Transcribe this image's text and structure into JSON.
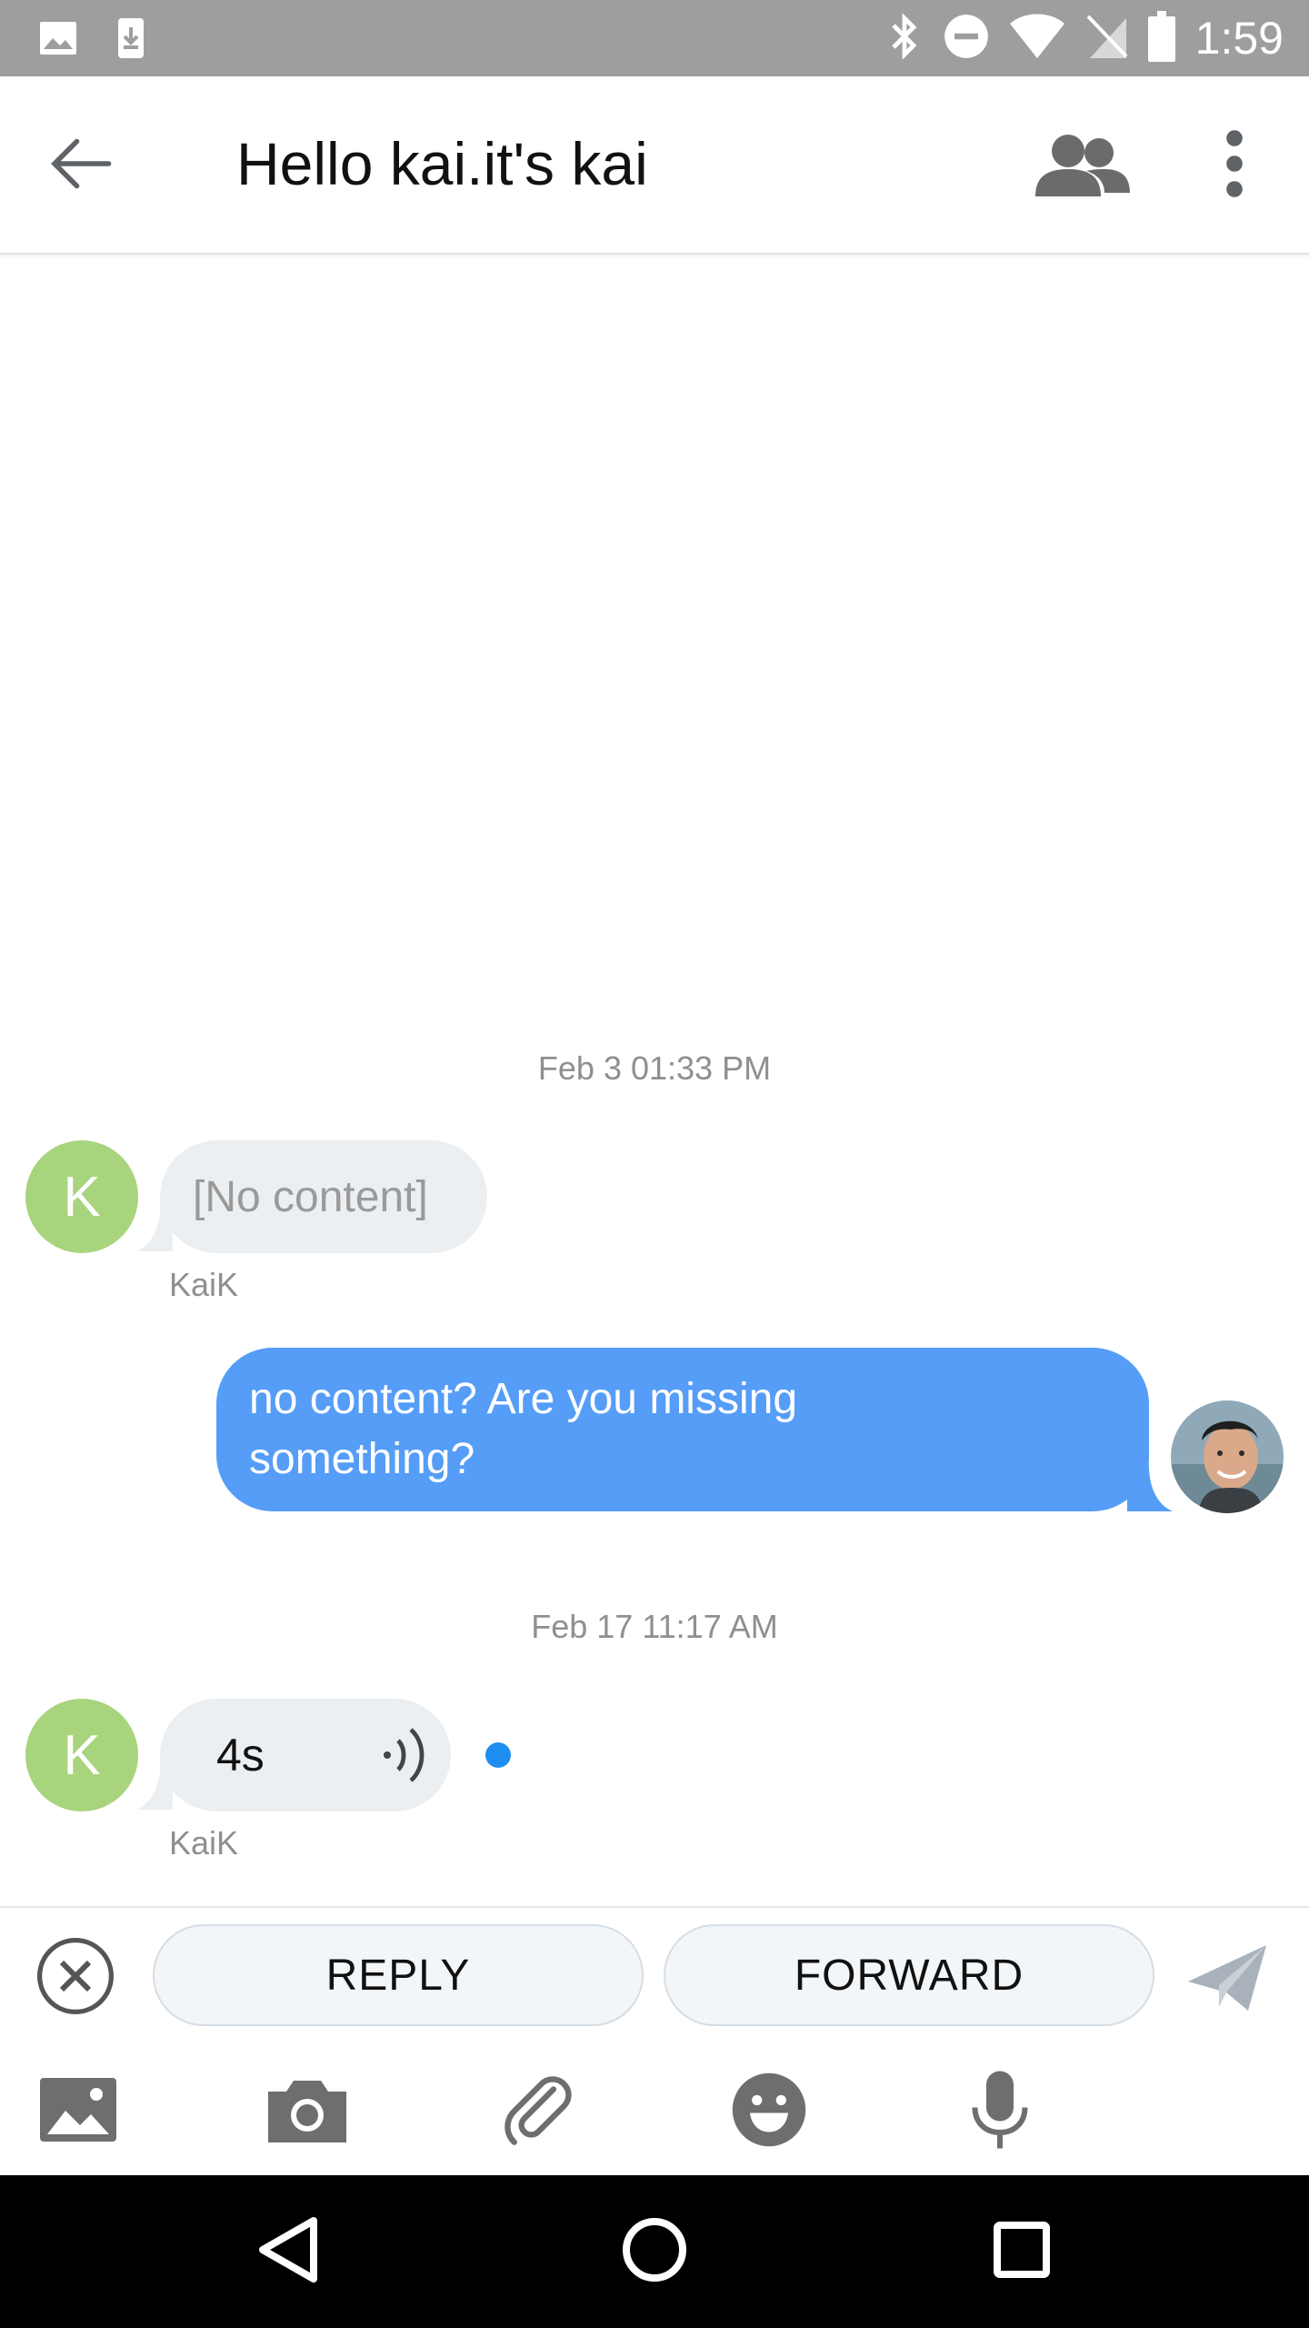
{
  "status_bar": {
    "time": "1:59",
    "icons": [
      "image-icon",
      "download-icon",
      "bluetooth-icon",
      "do-not-disturb-icon",
      "wifi-icon",
      "no-sim-icon",
      "battery-icon"
    ]
  },
  "header": {
    "title": "Hello kai.it's kai",
    "icons": [
      "back-arrow-icon",
      "people-icon",
      "more-vert-icon"
    ]
  },
  "conversation": {
    "groups": [
      {
        "timestamp": "Feb 3 01:33 PM",
        "incoming": {
          "avatar_letter": "K",
          "text": "[No content]",
          "sender": "KaiK"
        },
        "outgoing": {
          "text": "no content?  Are you missing something?"
        }
      },
      {
        "timestamp": "Feb 17 11:17 AM",
        "incoming": {
          "avatar_letter": "K",
          "audio_duration": "4s",
          "sender": "KaiK",
          "unread_dot": true
        }
      }
    ]
  },
  "reply_bar": {
    "reply_label": "REPLY",
    "forward_label": "FORWARD",
    "icons": [
      "cancel-icon",
      "send-icon"
    ]
  },
  "attachment_bar": {
    "icons": [
      "gallery-icon",
      "camera-icon",
      "paperclip-icon",
      "emoji-icon",
      "microphone-icon"
    ]
  },
  "nav_bar": {
    "icons": [
      "nav-back-icon",
      "nav-home-icon",
      "nav-recents-icon"
    ]
  },
  "colors": {
    "status_bar": "#9e9e9e",
    "avatar_k": "#a8d47d",
    "bubble_incoming": "#eceff2",
    "bubble_outgoing": "#559df7",
    "unread_dot": "#1e8ff0",
    "icon_gray": "#6e6e6e"
  }
}
